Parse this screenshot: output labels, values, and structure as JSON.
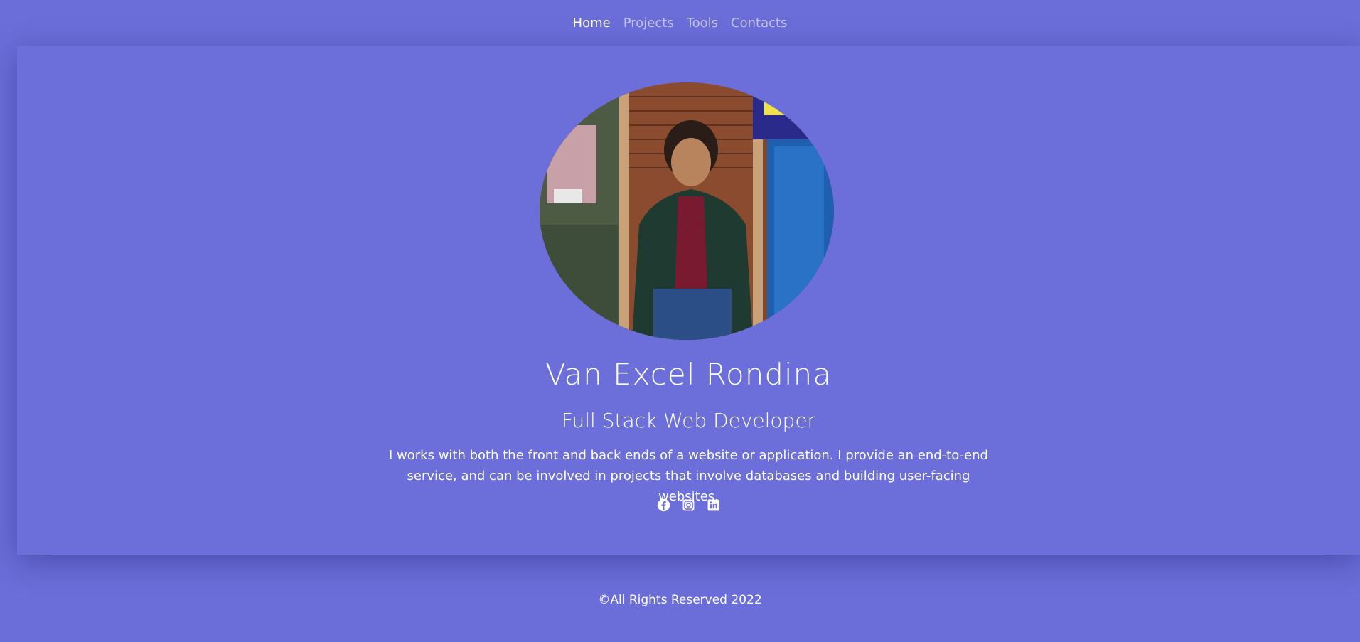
{
  "nav": {
    "links": [
      {
        "label": "Home",
        "active": true
      },
      {
        "label": "Projects",
        "active": false
      },
      {
        "label": "Tools",
        "active": false
      },
      {
        "label": "Contacts",
        "active": false
      }
    ]
  },
  "hero": {
    "name": "Van Excel Rondina",
    "role": "Full Stack Web Developer",
    "description": "I works with both the front and back ends of a website or application. I provide an end-to-end service, and can be involved in projects that involve databases and building user-facing websites.",
    "socials": [
      {
        "icon": "facebook-icon"
      },
      {
        "icon": "instagram-icon"
      },
      {
        "icon": "linkedin-icon"
      }
    ]
  },
  "footer": {
    "text": "©All Rights Reserved 2022"
  },
  "colors": {
    "background": "#6b6ed9",
    "text": "#ffffff",
    "nav_inactive": "rgba(255,255,255,0.6)"
  }
}
